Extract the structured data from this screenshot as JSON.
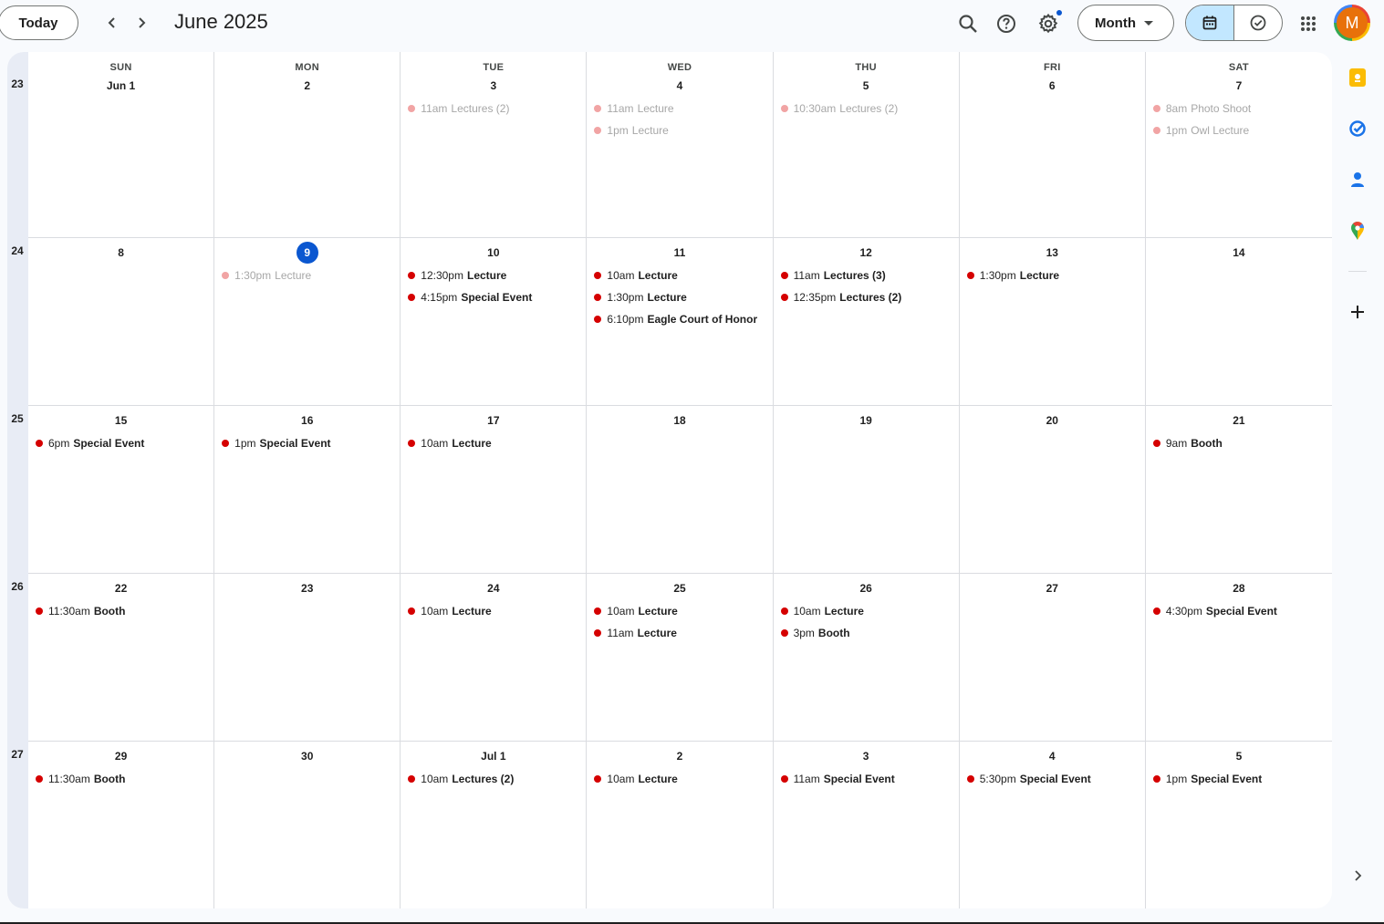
{
  "header": {
    "today_label": "Today",
    "title": "June 2025",
    "view_label": "Month",
    "avatar_initial": "M",
    "icons": [
      "chevron-left-icon",
      "chevron-right-icon",
      "search-icon",
      "help-icon",
      "settings-icon",
      "caret-down-icon",
      "calendar-icon",
      "tasks-icon",
      "apps-grid-icon"
    ]
  },
  "calendar": {
    "weekdays": [
      "SUN",
      "MON",
      "TUE",
      "WED",
      "THU",
      "FRI",
      "SAT"
    ],
    "weeks": [
      {
        "number": "23",
        "days": [
          {
            "date": "Jun 1",
            "events": []
          },
          {
            "date": "2",
            "events": []
          },
          {
            "date": "3",
            "events": [
              {
                "time": "11am",
                "name": "Lectures (2)",
                "past": true
              }
            ]
          },
          {
            "date": "4",
            "events": [
              {
                "time": "11am",
                "name": "Lecture",
                "past": true
              },
              {
                "time": "1pm",
                "name": "Lecture",
                "past": true
              }
            ]
          },
          {
            "date": "5",
            "events": [
              {
                "time": "10:30am",
                "name": "Lectures (2)",
                "past": true
              }
            ]
          },
          {
            "date": "6",
            "events": []
          },
          {
            "date": "7",
            "events": [
              {
                "time": "8am",
                "name": "Photo Shoot",
                "past": true
              },
              {
                "time": "1pm",
                "name": "Owl Lecture",
                "past": true
              }
            ]
          }
        ]
      },
      {
        "number": "24",
        "days": [
          {
            "date": "8",
            "events": []
          },
          {
            "date": "9",
            "today": true,
            "events": [
              {
                "time": "1:30pm",
                "name": "Lecture",
                "past": true
              }
            ]
          },
          {
            "date": "10",
            "events": [
              {
                "time": "12:30pm",
                "name": "Lecture"
              },
              {
                "time": "4:15pm",
                "name": "Special Event"
              }
            ]
          },
          {
            "date": "11",
            "events": [
              {
                "time": "10am",
                "name": "Lecture"
              },
              {
                "time": "1:30pm",
                "name": "Lecture"
              },
              {
                "time": "6:10pm",
                "name": "Eagle Court of Honor"
              }
            ]
          },
          {
            "date": "12",
            "events": [
              {
                "time": "11am",
                "name": "Lectures (3)"
              },
              {
                "time": "12:35pm",
                "name": "Lectures (2)"
              }
            ]
          },
          {
            "date": "13",
            "events": [
              {
                "time": "1:30pm",
                "name": "Lecture"
              }
            ]
          },
          {
            "date": "14",
            "events": []
          }
        ]
      },
      {
        "number": "25",
        "days": [
          {
            "date": "15",
            "events": [
              {
                "time": "6pm",
                "name": "Special Event"
              }
            ]
          },
          {
            "date": "16",
            "events": [
              {
                "time": "1pm",
                "name": "Special Event"
              }
            ]
          },
          {
            "date": "17",
            "events": [
              {
                "time": "10am",
                "name": "Lecture"
              }
            ]
          },
          {
            "date": "18",
            "events": []
          },
          {
            "date": "19",
            "events": []
          },
          {
            "date": "20",
            "events": []
          },
          {
            "date": "21",
            "events": [
              {
                "time": "9am",
                "name": "Booth"
              }
            ]
          }
        ]
      },
      {
        "number": "26",
        "days": [
          {
            "date": "22",
            "events": [
              {
                "time": "11:30am",
                "name": "Booth"
              }
            ]
          },
          {
            "date": "23",
            "events": []
          },
          {
            "date": "24",
            "events": [
              {
                "time": "10am",
                "name": "Lecture"
              }
            ]
          },
          {
            "date": "25",
            "events": [
              {
                "time": "10am",
                "name": "Lecture"
              },
              {
                "time": "11am",
                "name": "Lecture"
              }
            ]
          },
          {
            "date": "26",
            "events": [
              {
                "time": "10am",
                "name": "Lecture"
              },
              {
                "time": "3pm",
                "name": "Booth"
              }
            ]
          },
          {
            "date": "27",
            "events": []
          },
          {
            "date": "28",
            "events": [
              {
                "time": "4:30pm",
                "name": "Special Event"
              }
            ]
          }
        ]
      },
      {
        "number": "27",
        "days": [
          {
            "date": "29",
            "events": [
              {
                "time": "11:30am",
                "name": "Booth"
              }
            ]
          },
          {
            "date": "30",
            "events": []
          },
          {
            "date": "Jul 1",
            "events": [
              {
                "time": "10am",
                "name": "Lectures (2)"
              }
            ]
          },
          {
            "date": "2",
            "events": [
              {
                "time": "10am",
                "name": "Lecture"
              }
            ]
          },
          {
            "date": "3",
            "events": [
              {
                "time": "11am",
                "name": "Special Event"
              }
            ]
          },
          {
            "date": "4",
            "events": [
              {
                "time": "5:30pm",
                "name": "Special Event"
              }
            ]
          },
          {
            "date": "5",
            "events": [
              {
                "time": "1pm",
                "name": "Special Event"
              }
            ]
          }
        ]
      }
    ]
  },
  "side_panel": {
    "icons": [
      "keep-icon",
      "tasks-icon",
      "contacts-icon",
      "maps-icon",
      "add-icon",
      "expand-panel-icon"
    ]
  },
  "colors": {
    "event_dot": "#d50000",
    "past_event_dot": "#f1a4a4",
    "today_circle": "#0b57d0",
    "selected_view": "#c2e7ff"
  }
}
